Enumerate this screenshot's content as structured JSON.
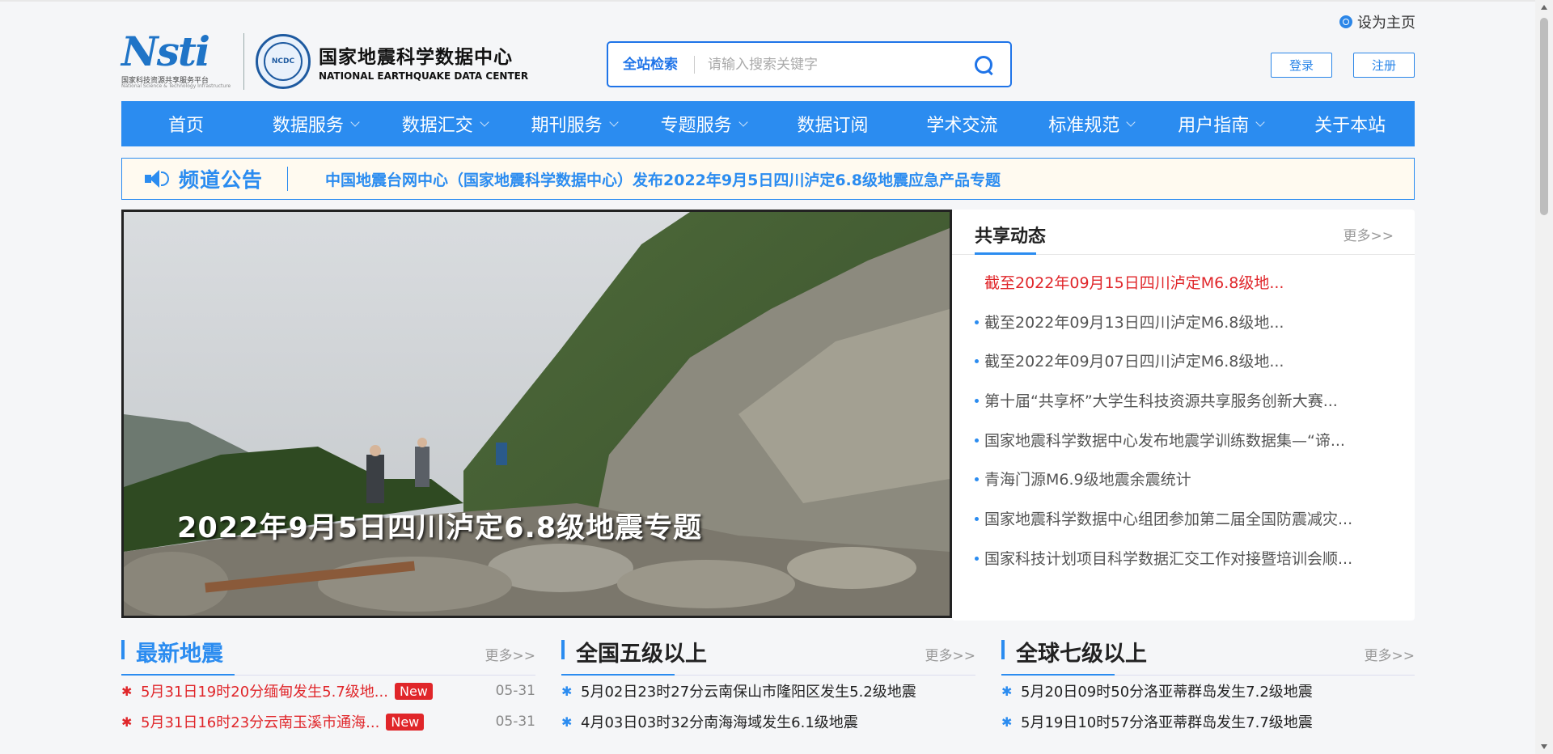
{
  "header": {
    "set_home": "设为主页",
    "nsti_logo": "Nsti",
    "nsti_sub_cn": "国家科技资源共享服务平台",
    "nsti_sub_en": "National Science & Technology Infrastructure",
    "seal_text": "NCDC",
    "center_name_cn": "国家地震科学数据中心",
    "center_name_en": "NATIONAL EARTHQUAKE DATA CENTER",
    "search_scope": "全站检索",
    "search_placeholder": "请输入搜索关键字",
    "login": "登录",
    "register": "注册"
  },
  "nav": [
    {
      "label": "首页",
      "dropdown": false
    },
    {
      "label": "数据服务",
      "dropdown": true
    },
    {
      "label": "数据汇交",
      "dropdown": true
    },
    {
      "label": "期刊服务",
      "dropdown": true
    },
    {
      "label": "专题服务",
      "dropdown": true
    },
    {
      "label": "数据订阅",
      "dropdown": false
    },
    {
      "label": "学术交流",
      "dropdown": false
    },
    {
      "label": "标准规范",
      "dropdown": true
    },
    {
      "label": "用户指南",
      "dropdown": true
    },
    {
      "label": "关于本站",
      "dropdown": false
    }
  ],
  "notice": {
    "title": "频道公告",
    "text": "中国地震台网中心（国家地震科学数据中心）发布2022年9月5日四川泸定6.8级地震应急产品专题"
  },
  "banner": {
    "caption": "2022年9月5日四川泸定6.8级地震专题"
  },
  "share": {
    "title": "共享动态",
    "more": "更多>>",
    "items": [
      "截至2022年09月15日四川泸定M6.8级地...",
      "截至2022年09月13日四川泸定M6.8级地...",
      "截至2022年09月07日四川泸定M6.8级地...",
      "第十届“共享杯”大学生科技资源共享服务创新大赛...",
      "国家地震科学数据中心发布地震学训练数据集—“谛...",
      "青海门源M6.9级地震余震统计",
      "国家地震科学数据中心组团参加第二届全国防震减灾...",
      "国家科技计划项目科学数据汇交工作对接暨培训会顺..."
    ]
  },
  "latest": {
    "title": "最新地震",
    "more": "更多>>",
    "rows": [
      {
        "text": "5月31日19时20分缅甸发生5.7级地...",
        "badge": "New",
        "date": "05-31"
      },
      {
        "text": "5月31日16时23分云南玉溪市通海...",
        "badge": "New",
        "date": "05-31"
      }
    ]
  },
  "national": {
    "title": "全国五级以上",
    "more": "更多>>",
    "rows": [
      {
        "text": "5月02日23时27分云南保山市隆阳区发生5.2级地震"
      },
      {
        "text": "4月03日03时32分南海海域发生6.1级地震"
      }
    ]
  },
  "global": {
    "title": "全球七级以上",
    "more": "更多>>",
    "rows": [
      {
        "text": "5月20日09时50分洛亚蒂群岛发生7.2级地震"
      },
      {
        "text": "5月19日10时57分洛亚蒂群岛发生7.7级地震"
      }
    ]
  },
  "colors": {
    "primary": "#2b8cf0",
    "alert": "#e0262a"
  }
}
